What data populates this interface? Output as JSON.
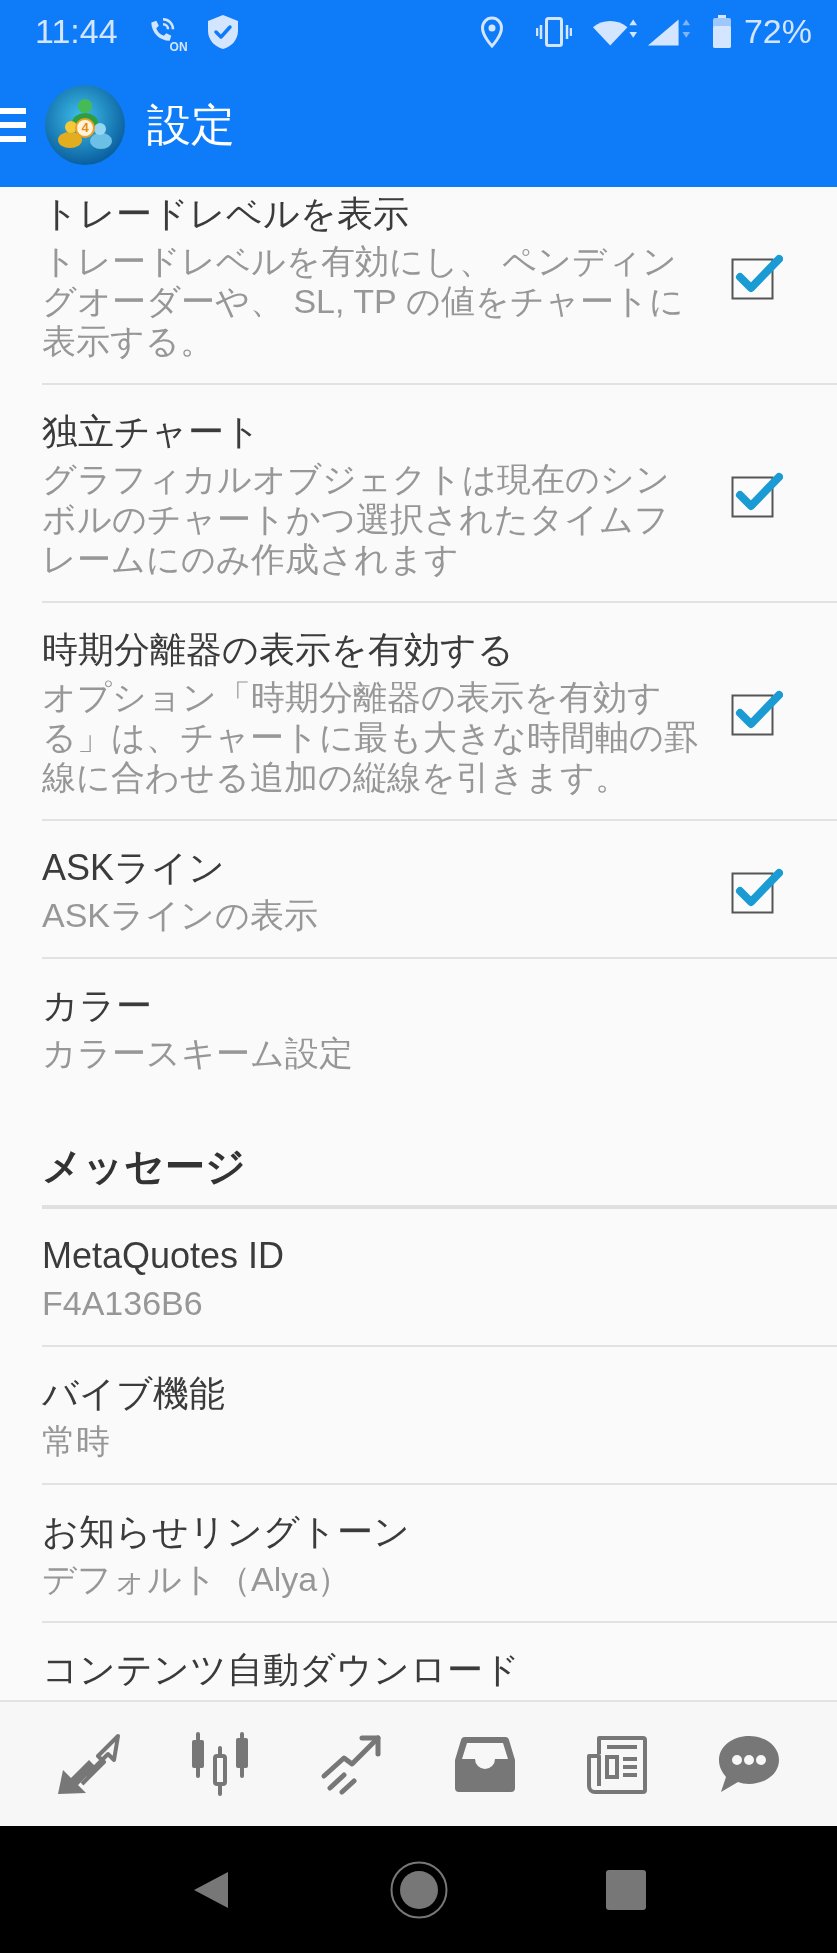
{
  "status_bar": {
    "time": "11:44",
    "nfc_label": "ON",
    "battery": "72%"
  },
  "app_bar": {
    "logo_badge": "4",
    "title": "設定"
  },
  "settings": [
    {
      "kind": "checkbox",
      "title": "トレードレベルを表示",
      "description": "トレードレベルを有効にし、 ペンディングオーダーや、 SL, TP の値をチャートに表示する。",
      "checked": true
    },
    {
      "kind": "checkbox",
      "title": "独立チャート",
      "description": "グラフィカルオブジェクトは現在のシンボルのチャートかつ選択されたタイムフレームにのみ作成されます",
      "checked": true
    },
    {
      "kind": "checkbox",
      "title": "時期分離器の表示を有効する",
      "description": "オプション「時期分離器の表示を有効する」は、チャートに最も大きな時間軸の罫線に合わせる追加の縦線を引きます。",
      "checked": true
    },
    {
      "kind": "checkbox",
      "title": "ASKライン",
      "description": "ASKラインの表示",
      "checked": true
    },
    {
      "kind": "link",
      "title": "カラー",
      "description": "カラースキーム設定"
    }
  ],
  "messages": {
    "heading": "メッセージ",
    "items": [
      {
        "kind": "link",
        "title": "MetaQuotes ID",
        "description": "F4A136B6"
      },
      {
        "kind": "link",
        "title": "バイブ機能",
        "description": "常時"
      },
      {
        "kind": "link",
        "title": "お知らせリングトーン",
        "description": "デフォルト（Alya）"
      },
      {
        "kind": "link",
        "title": "コンテンツ自動ダウンロード"
      }
    ]
  }
}
